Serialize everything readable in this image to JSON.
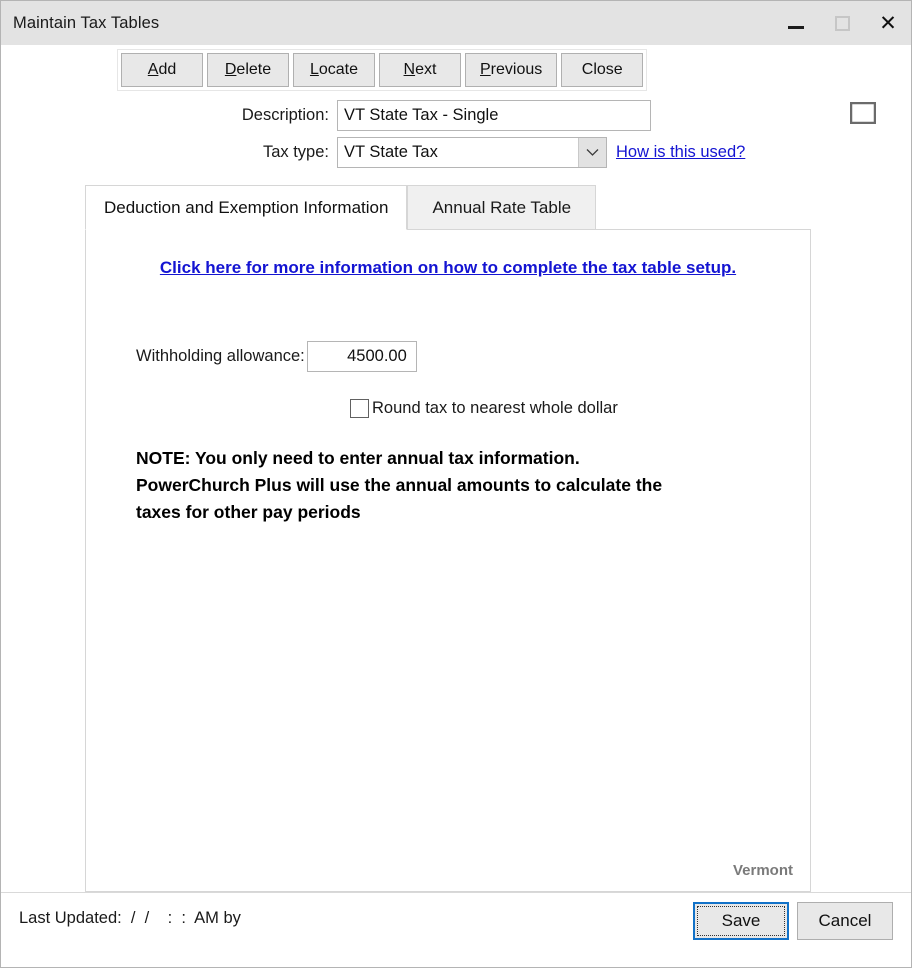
{
  "window": {
    "title": "Maintain Tax Tables",
    "caption": {
      "minimize": "minimize",
      "maximize": "maximize",
      "close": "✕"
    }
  },
  "toolbar": {
    "buttons": [
      {
        "mnemonic": "A",
        "rest": "dd"
      },
      {
        "mnemonic": "D",
        "rest": "elete"
      },
      {
        "mnemonic": "L",
        "rest": "ocate"
      },
      {
        "mnemonic": "N",
        "rest": "ext"
      },
      {
        "mnemonic": "P",
        "rest": "revious"
      },
      {
        "mnemonic": "",
        "rest": "Close"
      }
    ],
    "layout_icon": "layout-panel-icon"
  },
  "form": {
    "description_label": "Description:",
    "description_value": "VT State Tax - Single",
    "description_placeholder": "",
    "tax_type_label": "Tax type:",
    "tax_type_value": "VT State Tax",
    "tax_type_arrow": "⌄",
    "help_link": "How is this used?"
  },
  "tabs": [
    {
      "label": "Deduction and Exemption Information",
      "active": true
    },
    {
      "label": "Annual Rate Table",
      "active": false
    }
  ],
  "panel": {
    "info_link": "Click here for more information on how to complete the tax table setup.",
    "withholding_label": "Withholding allowance:",
    "withholding_value": "4500.00",
    "round_checkbox_label": "Round tax to nearest whole dollar",
    "round_checkbox_checked": false,
    "note": "NOTE: You only need to enter annual tax information. PowerChurch Plus will use the annual amounts to calculate the taxes for other pay periods",
    "state": "Vermont"
  },
  "footer": {
    "last_updated": "Last Updated:  /  /    :  :  AM by",
    "save_label": "Save",
    "cancel_label": "Cancel"
  },
  "colors": {
    "link": "#1414d2",
    "titlebar": "#e3e3e3",
    "accent_focus": "#1272c8",
    "state_label": "#7a7a7a"
  }
}
